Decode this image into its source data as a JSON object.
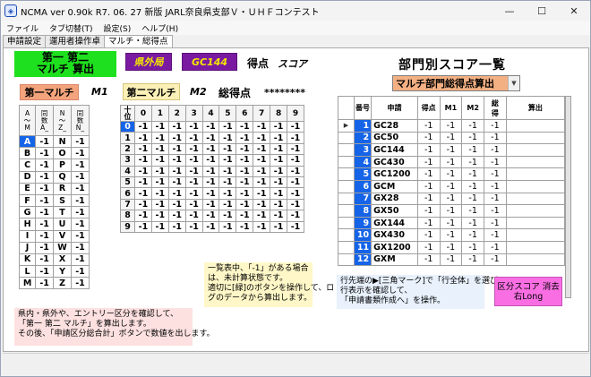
{
  "window": {
    "title": "NCMA ver 0.90k  R7. 06. 27 新版 JARL奈良県支部Ｖ・ＵＨＦコンテスト",
    "icon": "app-icon",
    "controls": {
      "minimize": "—",
      "maximize": "☐",
      "close": "✕"
    }
  },
  "menu": [
    "ファイル",
    "タブ切替(T)",
    "設定(S)",
    "ヘルプ(H)"
  ],
  "tabs": [
    "申請設定",
    "運用者操作卓",
    "マルチ・総得点"
  ],
  "top": {
    "green_line1": "第一 第二",
    "green_line2": "マルチ 算出",
    "pref_button": "県外局",
    "band_button": "GC144",
    "score_label": "得点",
    "score_value": "スコア",
    "first_multi_button": "第一マルチ",
    "m1_label": "M1",
    "second_multi_button": "第二マルチ",
    "m2_label": "M2",
    "total_label": "総得点",
    "total_value": "********"
  },
  "az_table": {
    "headers": [
      "A\n～\nM",
      "同\n数\nA_",
      "N\n～\nZ_",
      "同\n数\nN_"
    ],
    "rows": [
      [
        "A",
        "-1",
        "N",
        "-1"
      ],
      [
        "B",
        "-1",
        "O",
        "-1"
      ],
      [
        "C",
        "-1",
        "P",
        "-1"
      ],
      [
        "D",
        "-1",
        "Q",
        "-1"
      ],
      [
        "E",
        "-1",
        "R",
        "-1"
      ],
      [
        "F",
        "-1",
        "S",
        "-1"
      ],
      [
        "G",
        "-1",
        "T",
        "-1"
      ],
      [
        "H",
        "-1",
        "U",
        "-1"
      ],
      [
        "I",
        "-1",
        "V",
        "-1"
      ],
      [
        "J",
        "-1",
        "W",
        "-1"
      ],
      [
        "K",
        "-1",
        "X",
        "-1"
      ],
      [
        "L",
        "-1",
        "Y",
        "-1"
      ],
      [
        "M",
        "-1",
        "Z",
        "-1"
      ]
    ]
  },
  "num_table": {
    "corner": "十\n位",
    "columns": [
      "0",
      "1",
      "2",
      "3",
      "4",
      "5",
      "6",
      "7",
      "8",
      "9"
    ],
    "rows": [
      {
        "label": "0",
        "values": [
          "-1",
          "-1",
          "-1",
          "-1",
          "-1",
          "-1",
          "-1",
          "-1",
          "-1",
          "-1"
        ]
      },
      {
        "label": "1",
        "values": [
          "-1",
          "-1",
          "-1",
          "-1",
          "-1",
          "-1",
          "-1",
          "-1",
          "-1",
          "-1"
        ]
      },
      {
        "label": "2",
        "values": [
          "-1",
          "-1",
          "-1",
          "-1",
          "-1",
          "-1",
          "-1",
          "-1",
          "-1",
          "-1"
        ]
      },
      {
        "label": "3",
        "values": [
          "-1",
          "-1",
          "-1",
          "-1",
          "-1",
          "-1",
          "-1",
          "-1",
          "-1",
          "-1"
        ]
      },
      {
        "label": "4",
        "values": [
          "-1",
          "-1",
          "-1",
          "-1",
          "-1",
          "-1",
          "-1",
          "-1",
          "-1",
          "-1"
        ]
      },
      {
        "label": "5",
        "values": [
          "-1",
          "-1",
          "-1",
          "-1",
          "-1",
          "-1",
          "-1",
          "-1",
          "-1",
          "-1"
        ]
      },
      {
        "label": "6",
        "values": [
          "-1",
          "-1",
          "-1",
          "-1",
          "-1",
          "-1",
          "-1",
          "-1",
          "-1",
          "-1"
        ]
      },
      {
        "label": "7",
        "values": [
          "-1",
          "-1",
          "-1",
          "-1",
          "-1",
          "-1",
          "-1",
          "-1",
          "-1",
          "-1"
        ]
      },
      {
        "label": "8",
        "values": [
          "-1",
          "-1",
          "-1",
          "-1",
          "-1",
          "-1",
          "-1",
          "-1",
          "-1",
          "-1"
        ]
      },
      {
        "label": "9",
        "values": [
          "-1",
          "-1",
          "-1",
          "-1",
          "-1",
          "-1",
          "-1",
          "-1",
          "-1",
          "-1"
        ]
      }
    ]
  },
  "score_list": {
    "title": "部門別スコア一覧",
    "select_value": "マルチ部門総得点算出",
    "headers": [
      "",
      "番号",
      "申請",
      "得点",
      "M1",
      "M2",
      "総\n得",
      "算出"
    ],
    "rows": [
      [
        "▶",
        "1",
        "GC28",
        "-1",
        "-1",
        "-1",
        "-1",
        ""
      ],
      [
        "",
        "2",
        "GC50",
        "-1",
        "-1",
        "-1",
        "-1",
        ""
      ],
      [
        "",
        "3",
        "GC144",
        "-1",
        "-1",
        "-1",
        "-1",
        ""
      ],
      [
        "",
        "4",
        "GC430",
        "-1",
        "-1",
        "-1",
        "-1",
        ""
      ],
      [
        "",
        "5",
        "GC1200",
        "-1",
        "-1",
        "-1",
        "-1",
        ""
      ],
      [
        "",
        "6",
        "GCM",
        "-1",
        "-1",
        "-1",
        "-1",
        ""
      ],
      [
        "",
        "7",
        "GX28",
        "-1",
        "-1",
        "-1",
        "-1",
        ""
      ],
      [
        "",
        "8",
        "GX50",
        "-1",
        "-1",
        "-1",
        "-1",
        ""
      ],
      [
        "",
        "9",
        "GX144",
        "-1",
        "-1",
        "-1",
        "-1",
        ""
      ],
      [
        "",
        "10",
        "GX430",
        "-1",
        "-1",
        "-1",
        "-1",
        ""
      ],
      [
        "",
        "11",
        "GX1200",
        "-1",
        "-1",
        "-1",
        "-1",
        ""
      ],
      [
        "",
        "12",
        "GXM",
        "-1",
        "-1",
        "-1",
        "-1",
        ""
      ]
    ]
  },
  "notes": {
    "yellow": "一覧表中、「-1」がある場合\nは、未計算状態です。\n適切に[緑]のボタンを操作して、ロ\nグのデータから算出します。",
    "pink_left": "県内・県外や、エントリー区分を確認して、\n「第一 第二 マルチ」を算出します。\nその後、「申請区分総合計」ボタンで数値を出します。",
    "blue": "行先端の▶[三角マーク]で「行全体」を選び、\n行表示を確認して、\n「申請書類作成へ」を操作。"
  },
  "clear_button": {
    "line1": "区分スコア 消去",
    "line2": "右Long"
  },
  "colors": {
    "green": "#1ee01e",
    "purple": "#7a1aa1",
    "yellow_text": "#f2e600",
    "selected_blue": "#1564e8",
    "salmon": "#f3a47c",
    "pink": "#f96fe3"
  }
}
